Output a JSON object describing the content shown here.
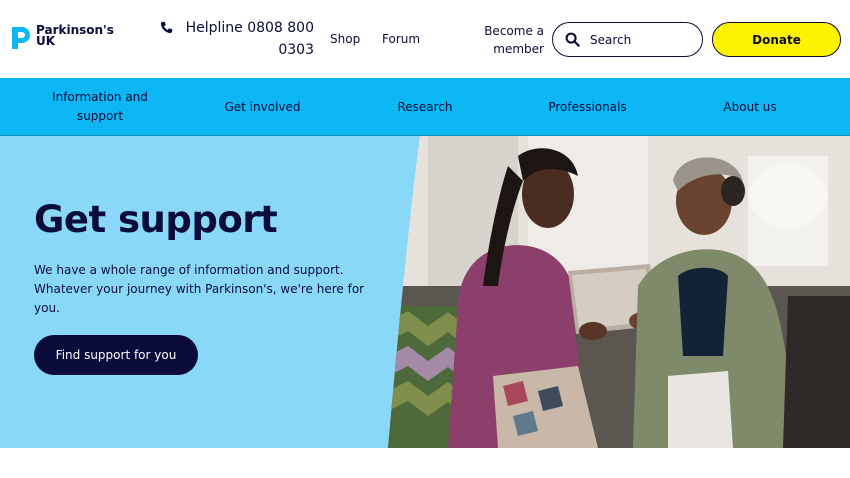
{
  "brand": {
    "line1": "Parkinson's",
    "line2": "UK",
    "color": "#0db7f4"
  },
  "header": {
    "helpline_label": "Helpline 0808 800 0303",
    "shop_label": "Shop",
    "forum_label": "Forum",
    "become_member_label": "Become a member",
    "search_placeholder": "Search",
    "donate_label": "Donate",
    "donate_color": "#fff200"
  },
  "nav": {
    "items": [
      {
        "label": "Information and support"
      },
      {
        "label": "Get involved"
      },
      {
        "label": "Research"
      },
      {
        "label": "Professionals"
      },
      {
        "label": "About us"
      }
    ],
    "color": "#0db7f4"
  },
  "hero": {
    "title": "Get support",
    "text": "We have a whole range of information and support. Whatever your journey with Parkinson's, we're here for you.",
    "button_label": "Find support for you",
    "background": "#8ad8f8"
  },
  "icons": {
    "phone": "phone-icon",
    "search": "search-icon",
    "logo": "parkinsons-logo-icon"
  }
}
